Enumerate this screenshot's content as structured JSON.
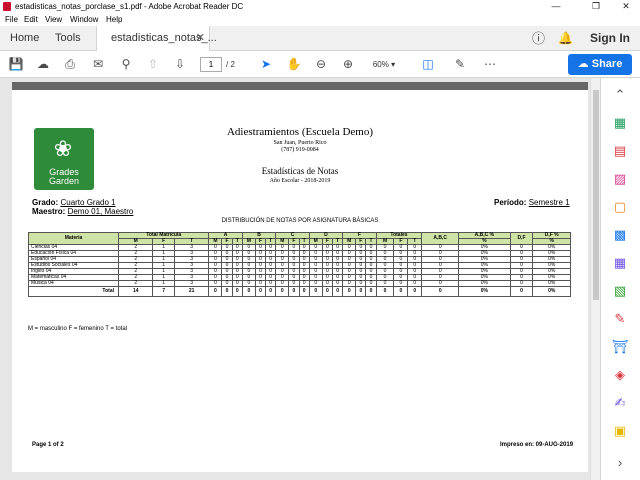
{
  "window": {
    "title": "estadisticas_notas_porclase_s1.pdf - Adobe Acrobat Reader DC"
  },
  "menu": [
    "File",
    "Edit",
    "View",
    "Window",
    "Help"
  ],
  "tabs": {
    "home": "Home",
    "tools": "Tools",
    "doc": "estadisticas_notas_...",
    "sign_in": "Sign In"
  },
  "toolbar": {
    "page_current": "1",
    "page_total": "/ 2",
    "zoom": "60%",
    "share": "Share"
  },
  "doc": {
    "school": "Adiestramientos (Escuela Demo)",
    "city": "San Juan, Puerto Rico",
    "phone": "(787) 919-0084",
    "report_title": "Estadísticas de Notas",
    "school_year": "Año Escolar - 2018-2019",
    "logo_text_1": "Grades",
    "logo_text_2": "Garden",
    "grado_label": "Grado:",
    "grado_value": "Cuarto Grado 1",
    "maestro_label": "Maestro:",
    "maestro_value": "Demo 01, Maestro",
    "periodo_label": "Período:",
    "periodo_value": "Semestre 1",
    "subtitle": "DISTRIBUCIÓN DE NOTAS POR ASIGNATURA BÁSICAS",
    "legend": "M = masculino    F = femenino    T = total",
    "page_label": "Page 1 of 2",
    "printed": "Impreso en: 09-AUG-2019"
  },
  "table": {
    "col_materia": "Materia",
    "col_total_matricula": "Total Matrícula",
    "grades": [
      "A",
      "B",
      "C",
      "D",
      "F",
      "Totales"
    ],
    "col_abc": "A,B,C",
    "col_abc_pct": "A,B,C %",
    "col_df": "D,F",
    "col_df_pct": "D,F %",
    "sub_m": "M",
    "sub_f": "F",
    "sub_t": "T",
    "pct_sign": "%",
    "rows": [
      {
        "materia": "Ciencias 04",
        "vals": [
          "2",
          "1",
          "3",
          "0",
          "0",
          "0",
          "0",
          "0",
          "0",
          "0",
          "0",
          "0",
          "0",
          "0",
          "0",
          "0",
          "0",
          "0",
          "0",
          "0",
          "0",
          "0",
          "0%",
          "0",
          "0%"
        ]
      },
      {
        "materia": "Educación Física 04",
        "vals": [
          "2",
          "1",
          "3",
          "0",
          "0",
          "0",
          "0",
          "0",
          "0",
          "0",
          "0",
          "0",
          "0",
          "0",
          "0",
          "0",
          "0",
          "0",
          "0",
          "0",
          "0",
          "0",
          "0%",
          "0",
          "0%"
        ]
      },
      {
        "materia": "Español 04",
        "vals": [
          "2",
          "1",
          "3",
          "0",
          "0",
          "0",
          "0",
          "0",
          "0",
          "0",
          "0",
          "0",
          "0",
          "0",
          "0",
          "0",
          "0",
          "0",
          "0",
          "0",
          "0",
          "0",
          "0%",
          "0",
          "0%"
        ]
      },
      {
        "materia": "Estudios Sociales 04",
        "vals": [
          "2",
          "1",
          "3",
          "0",
          "0",
          "0",
          "0",
          "0",
          "0",
          "0",
          "0",
          "0",
          "0",
          "0",
          "0",
          "0",
          "0",
          "0",
          "0",
          "0",
          "0",
          "0",
          "0%",
          "0",
          "0%"
        ]
      },
      {
        "materia": "Inglés 04",
        "vals": [
          "2",
          "1",
          "3",
          "0",
          "0",
          "0",
          "0",
          "0",
          "0",
          "0",
          "0",
          "0",
          "0",
          "0",
          "0",
          "0",
          "0",
          "0",
          "0",
          "0",
          "0",
          "0",
          "0%",
          "0",
          "0%"
        ]
      },
      {
        "materia": "Matemáticas 04",
        "vals": [
          "2",
          "1",
          "3",
          "0",
          "0",
          "0",
          "0",
          "0",
          "0",
          "0",
          "0",
          "0",
          "0",
          "0",
          "0",
          "0",
          "0",
          "0",
          "0",
          "0",
          "0",
          "0",
          "0%",
          "0",
          "0%"
        ]
      },
      {
        "materia": "Música 04",
        "vals": [
          "2",
          "1",
          "3",
          "0",
          "0",
          "0",
          "0",
          "0",
          "0",
          "0",
          "0",
          "0",
          "0",
          "0",
          "0",
          "0",
          "0",
          "0",
          "0",
          "0",
          "0",
          "0",
          "0%",
          "0",
          "0%"
        ]
      }
    ],
    "total_label": "Total",
    "total_vals": [
      "14",
      "7",
      "21",
      "0",
      "0",
      "0",
      "0",
      "0",
      "0",
      "0",
      "0",
      "0",
      "0",
      "0",
      "0",
      "0",
      "0",
      "0",
      "0",
      "0",
      "0",
      "0",
      "0%",
      "0",
      "0%"
    ]
  },
  "colors": {
    "accent": "#1473e6",
    "header_green": "#cfe3a6",
    "logo_green": "#2e8b3a",
    "pdf_red": "#c8102e"
  }
}
